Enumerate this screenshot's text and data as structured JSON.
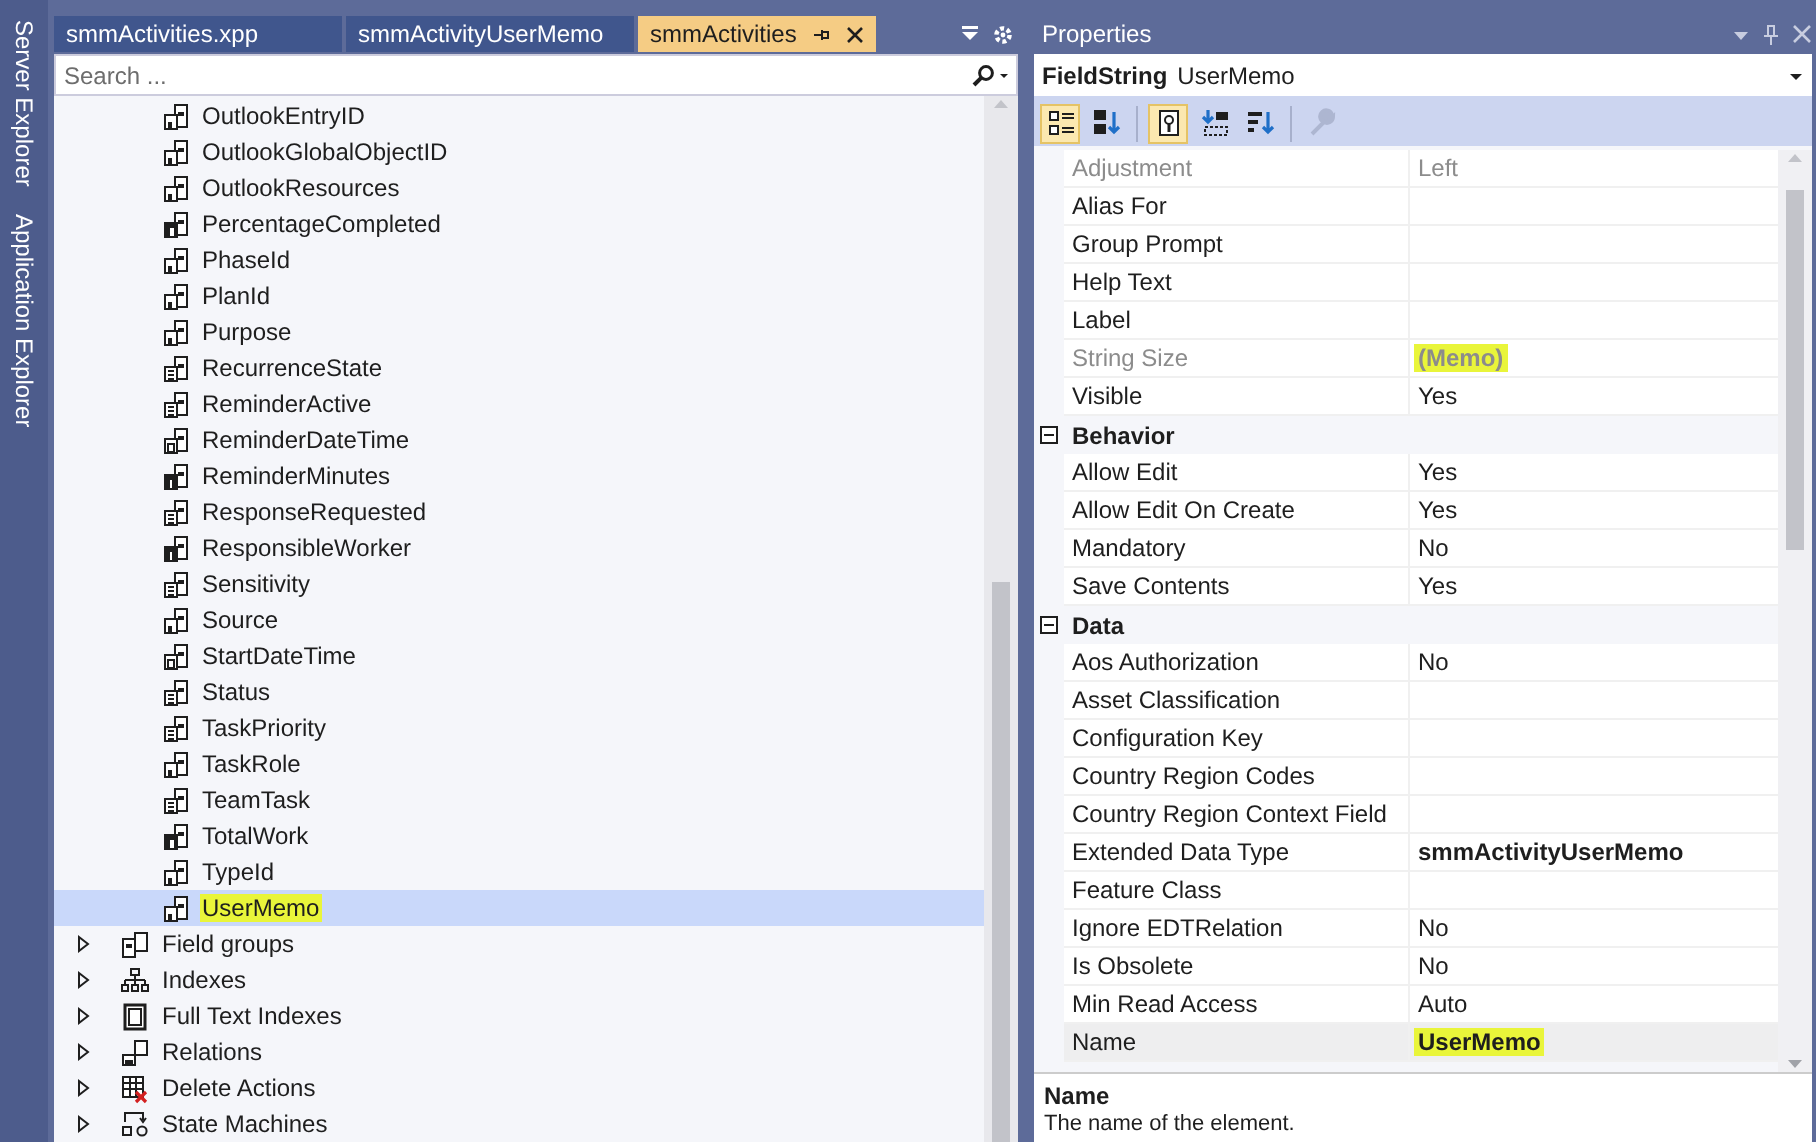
{
  "side_tabs": [
    {
      "label": "Server Explorer"
    },
    {
      "label": "Application Explorer"
    }
  ],
  "doc_tabs": [
    {
      "label": "smmActivities.xpp",
      "selected": false
    },
    {
      "label": "smmActivityUserMemo",
      "selected": false
    },
    {
      "label": "smmActivities",
      "selected": true
    }
  ],
  "search": {
    "placeholder": "Search ..."
  },
  "tree": {
    "fields": [
      {
        "label": "OutlookEntryID",
        "kind": "string",
        "selected": false,
        "highlighted": false
      },
      {
        "label": "OutlookGlobalObjectID",
        "kind": "string",
        "selected": false,
        "highlighted": false
      },
      {
        "label": "OutlookResources",
        "kind": "string",
        "selected": false,
        "highlighted": false
      },
      {
        "label": "PercentageCompleted",
        "kind": "real",
        "selected": false,
        "highlighted": false
      },
      {
        "label": "PhaseId",
        "kind": "string",
        "selected": false,
        "highlighted": false
      },
      {
        "label": "PlanId",
        "kind": "string",
        "selected": false,
        "highlighted": false
      },
      {
        "label": "Purpose",
        "kind": "string",
        "selected": false,
        "highlighted": false
      },
      {
        "label": "RecurrenceState",
        "kind": "enum",
        "selected": false,
        "highlighted": false
      },
      {
        "label": "ReminderActive",
        "kind": "enum",
        "selected": false,
        "highlighted": false
      },
      {
        "label": "ReminderDateTime",
        "kind": "datetime",
        "selected": false,
        "highlighted": false
      },
      {
        "label": "ReminderMinutes",
        "kind": "int",
        "selected": false,
        "highlighted": false
      },
      {
        "label": "ResponseRequested",
        "kind": "enum",
        "selected": false,
        "highlighted": false
      },
      {
        "label": "ResponsibleWorker",
        "kind": "int",
        "selected": false,
        "highlighted": false
      },
      {
        "label": "Sensitivity",
        "kind": "enum",
        "selected": false,
        "highlighted": false
      },
      {
        "label": "Source",
        "kind": "string",
        "selected": false,
        "highlighted": false
      },
      {
        "label": "StartDateTime",
        "kind": "datetime",
        "selected": false,
        "highlighted": false
      },
      {
        "label": "Status",
        "kind": "enum",
        "selected": false,
        "highlighted": false
      },
      {
        "label": "TaskPriority",
        "kind": "enum",
        "selected": false,
        "highlighted": false
      },
      {
        "label": "TaskRole",
        "kind": "string",
        "selected": false,
        "highlighted": false
      },
      {
        "label": "TeamTask",
        "kind": "enum",
        "selected": false,
        "highlighted": false
      },
      {
        "label": "TotalWork",
        "kind": "real",
        "selected": false,
        "highlighted": false
      },
      {
        "label": "TypeId",
        "kind": "string",
        "selected": false,
        "highlighted": false
      },
      {
        "label": "UserMemo",
        "kind": "string",
        "selected": true,
        "highlighted": true
      }
    ],
    "nodes": [
      {
        "label": "Field groups",
        "kind": "fieldgroups",
        "expanded": false
      },
      {
        "label": "Indexes",
        "kind": "indexes",
        "expanded": false
      },
      {
        "label": "Full Text Indexes",
        "kind": "fulltext",
        "expanded": false
      },
      {
        "label": "Relations",
        "kind": "relations",
        "expanded": false
      },
      {
        "label": "Delete Actions",
        "kind": "deleteactions",
        "expanded": false
      },
      {
        "label": "State Machines",
        "kind": "statemachines",
        "expanded": false
      }
    ]
  },
  "properties": {
    "title": "Properties",
    "object": {
      "type": "FieldString",
      "name": "UserMemo"
    },
    "toolbar": [
      {
        "kind": "categorized",
        "selected": true
      },
      {
        "kind": "alphabetical",
        "selected": false
      },
      {
        "kind": "properties",
        "selected": true
      },
      {
        "kind": "events",
        "selected": false
      },
      {
        "kind": "sort",
        "selected": false
      },
      {
        "kind": "wrench",
        "selected": false,
        "disabled": true
      }
    ],
    "groups": [
      {
        "rows": [
          {
            "name": "Adjustment",
            "value": "Left",
            "disabled": true,
            "bold": false,
            "highlighted": false,
            "selected": false
          },
          {
            "name": "Alias For",
            "disabled": false,
            "selected": false
          },
          {
            "name": "Group Prompt",
            "disabled": false,
            "selected": false
          },
          {
            "name": "Help Text",
            "disabled": false,
            "selected": false
          },
          {
            "name": "Label",
            "disabled": false,
            "selected": false
          },
          {
            "name": "String Size",
            "value": "(Memo)",
            "disabled": true,
            "bold": true,
            "highlighted": true,
            "selected": false
          },
          {
            "name": "Visible",
            "value": "Yes",
            "disabled": false,
            "bold": false,
            "highlighted": false,
            "selected": false
          }
        ]
      },
      {
        "title": "Behavior",
        "expanded": true,
        "rows": [
          {
            "name": "Allow Edit",
            "value": "Yes",
            "disabled": false,
            "bold": false,
            "highlighted": false,
            "selected": false
          },
          {
            "name": "Allow Edit On Create",
            "value": "Yes",
            "disabled": false,
            "bold": false,
            "highlighted": false,
            "selected": false
          },
          {
            "name": "Mandatory",
            "value": "No",
            "disabled": false,
            "bold": false,
            "highlighted": false,
            "selected": false
          },
          {
            "name": "Save Contents",
            "value": "Yes",
            "disabled": false,
            "bold": false,
            "highlighted": false,
            "selected": false
          }
        ]
      },
      {
        "title": "Data",
        "expanded": true,
        "rows": [
          {
            "name": "Aos Authorization",
            "value": "No",
            "disabled": false,
            "bold": false,
            "highlighted": false,
            "selected": false
          },
          {
            "name": "Asset Classification",
            "disabled": false,
            "selected": false
          },
          {
            "name": "Configuration Key",
            "disabled": false,
            "selected": false
          },
          {
            "name": "Country Region Codes",
            "disabled": false,
            "selected": false
          },
          {
            "name": "Country Region Context Field",
            "disabled": false,
            "selected": false
          },
          {
            "name": "Extended Data Type",
            "value": "smmActivityUserMemo",
            "disabled": false,
            "bold": true,
            "highlighted": false,
            "selected": false
          },
          {
            "name": "Feature Class",
            "disabled": false,
            "selected": false
          },
          {
            "name": "Ignore EDTRelation",
            "value": "No",
            "disabled": false,
            "bold": false,
            "highlighted": false,
            "selected": false
          },
          {
            "name": "Is Obsolete",
            "value": "No",
            "disabled": false,
            "bold": false,
            "highlighted": false,
            "selected": false
          },
          {
            "name": "Min Read Access",
            "value": "Auto",
            "disabled": false,
            "bold": false,
            "highlighted": false,
            "selected": false
          },
          {
            "name": "Name",
            "value": "UserMemo",
            "disabled": false,
            "bold": true,
            "highlighted": true,
            "selected": true
          }
        ]
      }
    ],
    "description": {
      "title": "Name",
      "text": "The name of the element."
    }
  }
}
